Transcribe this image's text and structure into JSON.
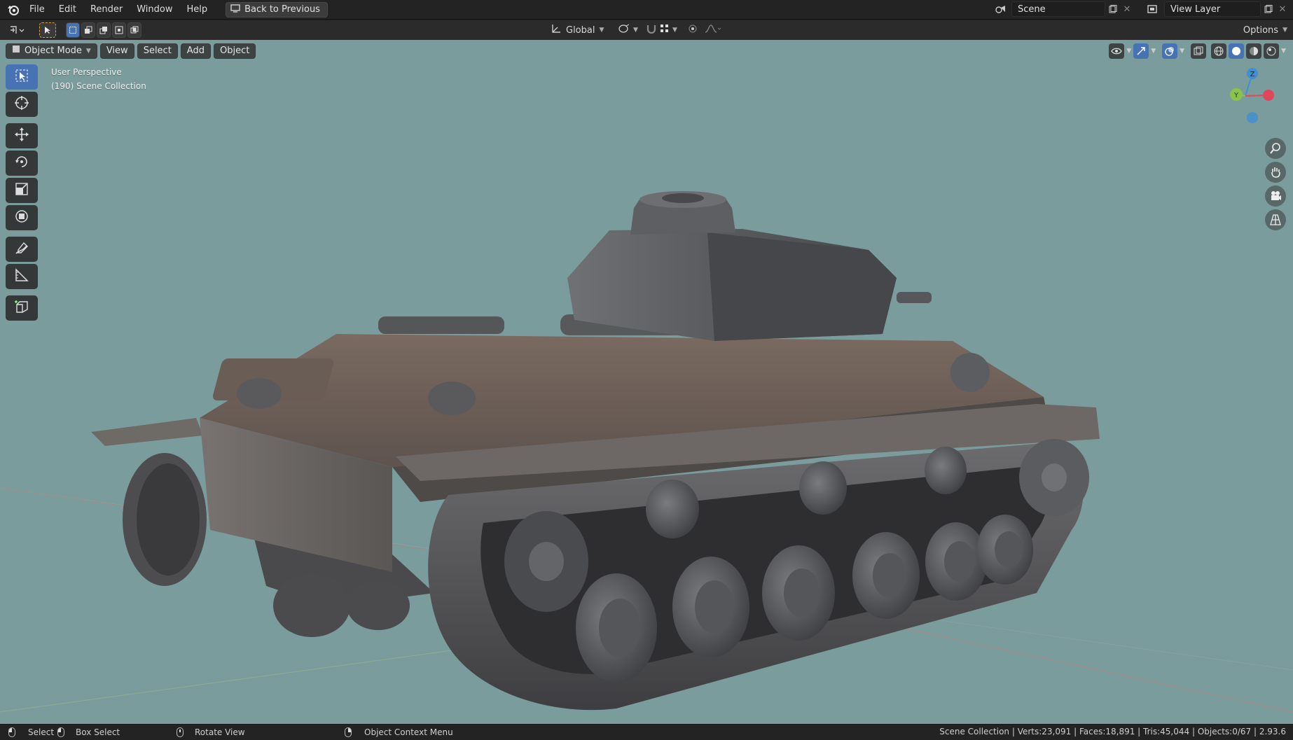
{
  "menubar": {
    "items": [
      "File",
      "Edit",
      "Render",
      "Window",
      "Help"
    ],
    "back_label": "Back to Previous",
    "scene_label": "Scene",
    "view_layer_label": "View Layer"
  },
  "header": {
    "transform_orientation": "Global",
    "options_label": "Options"
  },
  "viewport_header": {
    "mode_label": "Object Mode",
    "menus": [
      "View",
      "Select",
      "Add",
      "Object"
    ]
  },
  "viewport_info": {
    "line1": "User Perspective",
    "line2": "(190) Scene Collection"
  },
  "gizmo": {
    "z_label": "Z",
    "y_label": "Y",
    "colors": {
      "x": "#e0475a",
      "y": "#8bc34a",
      "z": "#3f8fd2"
    }
  },
  "toolshelf": [
    "select-box",
    "cursor",
    "move",
    "rotate",
    "scale",
    "transform",
    "annotate",
    "measure",
    "add-cube"
  ],
  "statusbar": {
    "select_label": "Select",
    "box_select_label": "Box Select",
    "rotate_label": "Rotate View",
    "context_menu_label": "Object Context Menu",
    "stats": "Scene Collection | Verts:23,091 | Faces:18,891 | Tris:45,044 | Objects:0/67 | 2.93.6"
  },
  "colors": {
    "accent": "#4772b3",
    "viewport_bg": "#7b9c9c"
  }
}
